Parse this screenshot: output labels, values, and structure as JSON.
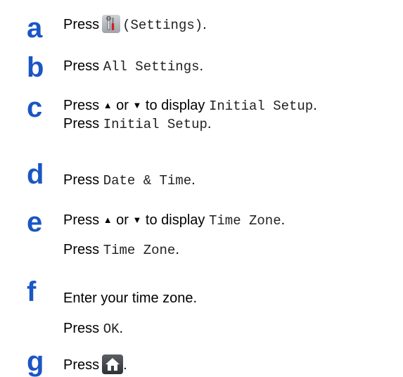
{
  "accent_color": "#1a56c4",
  "steps": [
    {
      "letter": "a",
      "lines": [
        {
          "t1": "Press",
          "c1": "(Settings)",
          "t2": "."
        }
      ]
    },
    {
      "letter": "b",
      "lines": [
        {
          "t1": "Press",
          "c1": "All Settings",
          "t2": "."
        }
      ]
    },
    {
      "letter": "c",
      "lines": [
        {
          "t1": "Press",
          "up": "▲",
          "or": "or",
          "down": "▼",
          "t2": "to display",
          "c1": "Initial Setup",
          "t3": "."
        },
        {
          "t1": "Press",
          "c1": "Initial Setup",
          "t2": "."
        }
      ]
    },
    {
      "letter": "d",
      "lines": [
        {
          "t1": "Press",
          "c1": "Date & Time",
          "t2": "."
        }
      ]
    },
    {
      "letter": "e",
      "lines": [
        {
          "t1": "Press",
          "up": "▲",
          "or": "or",
          "down": "▼",
          "t2": "to display",
          "c1": "Time Zone",
          "t3": "."
        },
        {
          "t1": "Press",
          "c1": "Time Zone",
          "t2": "."
        }
      ]
    },
    {
      "letter": "f",
      "lines": [
        {
          "t1": "Enter your time zone."
        },
        {
          "t1": "Press",
          "c1": "OK",
          "t2": "."
        }
      ]
    },
    {
      "letter": "g",
      "lines": [
        {
          "t1": "Press",
          "t2": "."
        }
      ]
    }
  ],
  "icons": {
    "settings": "settings-icon",
    "home": "home-icon"
  }
}
